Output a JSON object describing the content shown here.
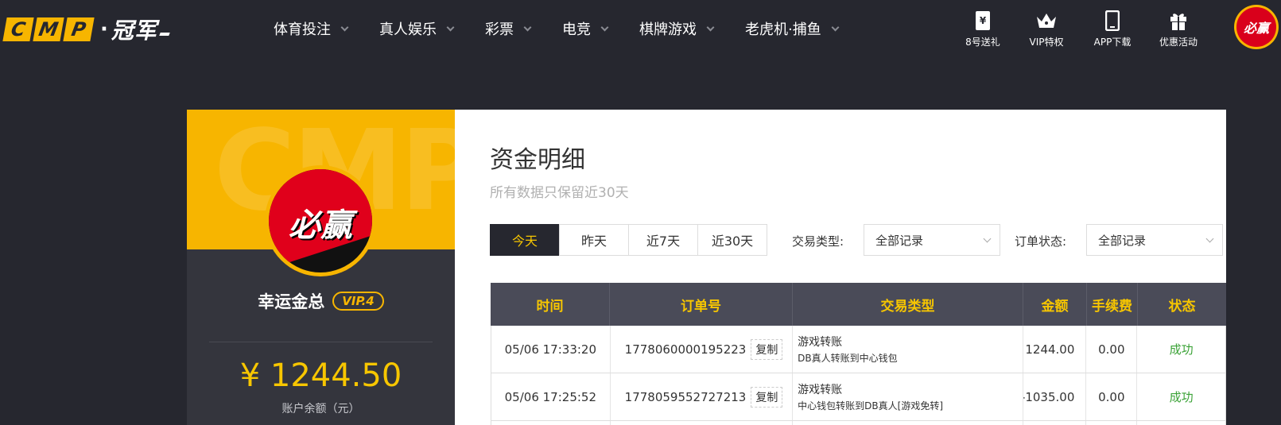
{
  "header": {
    "logo": {
      "letters": [
        "C",
        "M",
        "P"
      ],
      "dot": "·",
      "cn": "冠军"
    },
    "nav": [
      {
        "label": "体育投注"
      },
      {
        "label": "真人娱乐"
      },
      {
        "label": "彩票"
      },
      {
        "label": "电竞"
      },
      {
        "label": "棋牌游戏"
      },
      {
        "label": "老虎机·捕鱼"
      }
    ],
    "tools": [
      {
        "label": "8号送礼",
        "icon": "ticket-yen-icon"
      },
      {
        "label": "VIP特权",
        "icon": "crown-icon"
      },
      {
        "label": "APP下载",
        "icon": "phone-icon"
      },
      {
        "label": "优惠活动",
        "icon": "gift-icon"
      }
    ],
    "avatar_text": "必赢"
  },
  "sidebar": {
    "watermark": "CMP",
    "avatar_text": "必赢",
    "username": "幸运金总",
    "vip": "VIP.4",
    "balance": "¥ 1244.50",
    "balance_label": "账户余额（元）"
  },
  "main": {
    "title": "资金明细",
    "subtitle": "所有数据只保留近30天",
    "tabs": [
      {
        "label": "今天",
        "active": true
      },
      {
        "label": "昨天",
        "active": false
      },
      {
        "label": "近7天",
        "active": false
      },
      {
        "label": "近30天",
        "active": false
      }
    ],
    "filters": {
      "type_label": "交易类型:",
      "type_value": "全部记录",
      "status_label": "订单状态:",
      "status_value": "全部记录"
    },
    "table": {
      "headers": [
        "时间",
        "订单号",
        "交易类型",
        "金额",
        "手续费",
        "状态"
      ],
      "copy_label": "复制",
      "rows": [
        {
          "time": "05/06 17:33:20",
          "order": "1778060000195223",
          "type_main": "游戏转账",
          "type_sub": "DB真人转账到中心钱包",
          "amount": "1244.00",
          "fee": "0.00",
          "status": "成功"
        },
        {
          "time": "05/06 17:25:52",
          "order": "1778059552727213",
          "type_main": "游戏转账",
          "type_sub": "中心钱包转账到DB真人[游戏免转]",
          "amount": "-1035.00",
          "fee": "0.00",
          "status": "成功"
        }
      ]
    }
  },
  "colors": {
    "accent": "#f7b500",
    "dark_bg": "#26272f",
    "success": "#3aa236",
    "brand_red": "#e0001b"
  }
}
